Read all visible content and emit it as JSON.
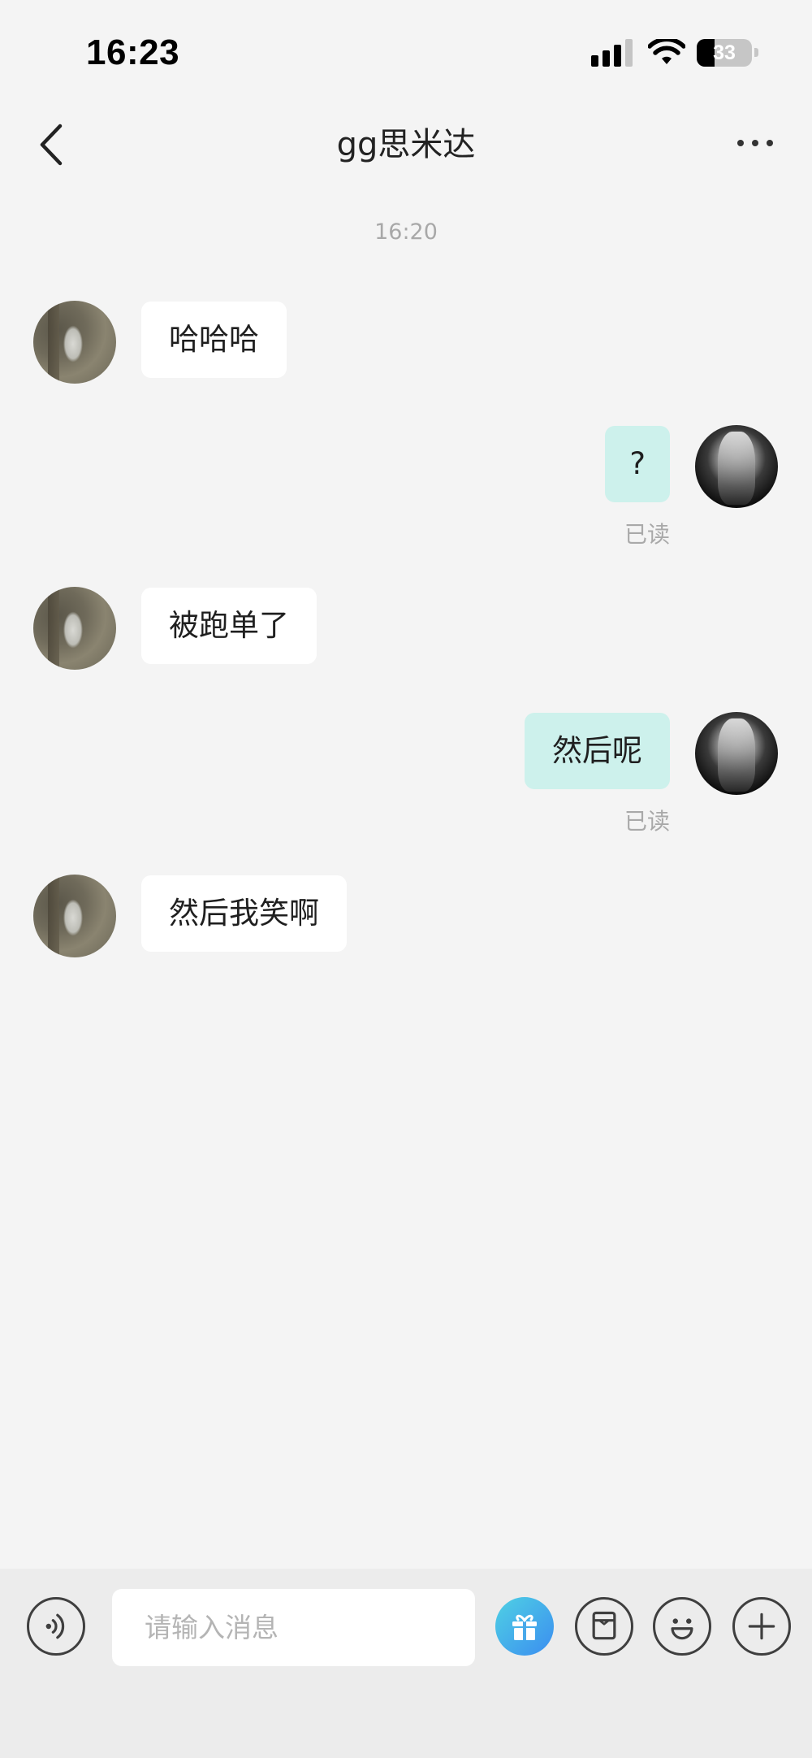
{
  "status_bar": {
    "time": "16:23",
    "battery": "33",
    "battery_level_percent": 33,
    "icons": [
      "signal-icon",
      "wifi-icon",
      "battery-icon"
    ]
  },
  "header": {
    "title": "gg思米达",
    "back_icon": "back-arrow-icon",
    "more_icon": "more-dots-icon"
  },
  "timestamp": "16:20",
  "messages": [
    {
      "sender": "other",
      "text": "哈哈哈"
    },
    {
      "sender": "self",
      "text": "?",
      "status": "已读"
    },
    {
      "sender": "other",
      "text": "被跑单了"
    },
    {
      "sender": "self",
      "text": "然后呢",
      "status": "已读"
    },
    {
      "sender": "other",
      "text": "然后我笑啊"
    }
  ],
  "input_bar": {
    "placeholder": "请输入消息",
    "buttons": [
      "voice-icon",
      "gift-icon",
      "red-packet-icon",
      "emoji-icon",
      "plus-icon"
    ]
  },
  "colors": {
    "background": "#f4f4f4",
    "incoming_bubble": "#ffffff",
    "outgoing_bubble": "#cdf1ec",
    "gift_gradient_start": "#4fd1e4",
    "gift_gradient_end": "#3b8df0"
  }
}
